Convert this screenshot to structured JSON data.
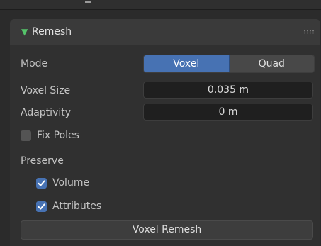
{
  "panel": {
    "title": "Remesh",
    "collapse_icon": "triangle-down-icon",
    "drag_icon": "grip-dots-icon"
  },
  "mode": {
    "label": "Mode",
    "options": [
      "Voxel",
      "Quad"
    ],
    "selected": "Voxel"
  },
  "voxel_size": {
    "label": "Voxel Size",
    "value": "0.035 m"
  },
  "adaptivity": {
    "label": "Adaptivity",
    "value": "0 m"
  },
  "fix_poles": {
    "label": "Fix Poles",
    "checked": false
  },
  "preserve": {
    "label": "Preserve",
    "volume": {
      "label": "Volume",
      "checked": true
    },
    "attributes": {
      "label": "Attributes",
      "checked": true
    }
  },
  "action": {
    "label": "Voxel Remesh"
  },
  "colors": {
    "accent": "#4772b3",
    "triangle": "#55c36a",
    "background": "#2b2b2b",
    "panel_body": "#303030",
    "header": "#3a3a3a"
  }
}
